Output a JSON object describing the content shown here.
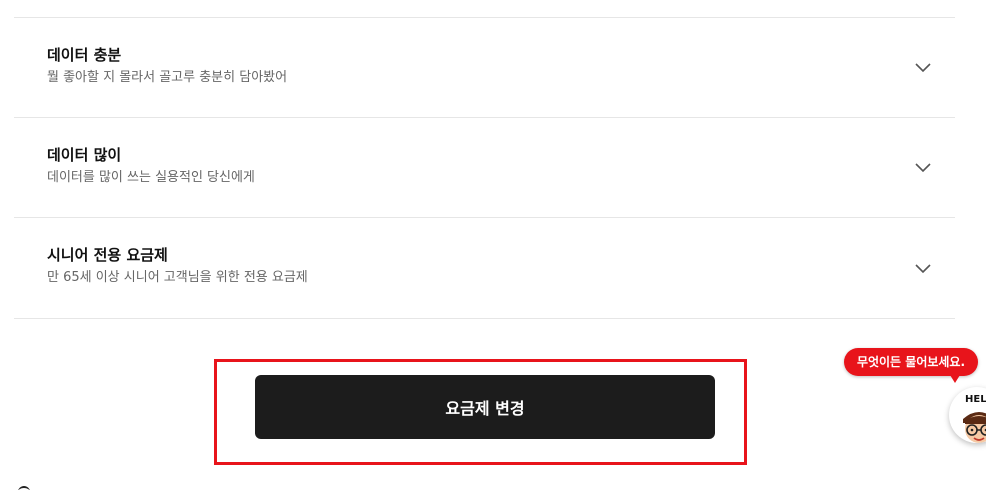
{
  "plans": [
    {
      "title": "데이터 충분",
      "description": "뭘 좋아할 지 몰라서 골고루 충분히 담아봤어",
      "chevron_icon": "chevron-down-icon"
    },
    {
      "title": "데이터 많이",
      "description": "데이터를 많이 쓰는 실용적인 당신에게",
      "chevron_icon": "chevron-down-icon"
    },
    {
      "title": "시니어 전용 요금제",
      "description": "만 65세 이상 시니어 고객님을 위한 전용 요금제",
      "chevron_icon": "chevron-down-icon"
    }
  ],
  "cta": {
    "label": "요금제 변경",
    "background": "#1c1c1c",
    "highlight_color": "#e8141b"
  },
  "help_widget": {
    "bubble_text": "무엇이든 물어보세요.",
    "avatar_text": "HEL",
    "bubble_color": "#e8141b"
  }
}
